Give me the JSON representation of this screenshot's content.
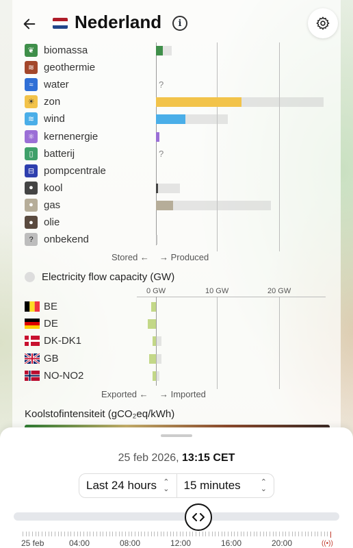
{
  "header": {
    "title": "Nederland",
    "back_icon": "arrow-left-icon",
    "info_icon": "i",
    "settings_icon": "gear-icon"
  },
  "production": {
    "items": [
      {
        "label": "biomassa",
        "icon": "leaf-icon",
        "color": "#3f8f4a",
        "symbol": "❦",
        "produced": 0.04,
        "capacity": 0.09
      },
      {
        "label": "geothermie",
        "icon": "geothermal-icon",
        "color": "#a3472b",
        "symbol": "≋",
        "produced": 0,
        "capacity": 0
      },
      {
        "label": "water",
        "icon": "water-icon",
        "color": "#2f6fd6",
        "symbol": "≈",
        "produced": null,
        "capacity": null,
        "unknown": "?"
      },
      {
        "label": "zon",
        "icon": "sun-icon",
        "color": "#f2c34a",
        "symbol": "☀",
        "produced": 0.5,
        "capacity": 0.98
      },
      {
        "label": "wind",
        "icon": "wind-icon",
        "color": "#4aaee8",
        "symbol": "≋",
        "produced": 0.17,
        "capacity": 0.42
      },
      {
        "label": "kernenergie",
        "icon": "atom-icon",
        "color": "#9b6fd6",
        "symbol": "⚛",
        "produced": 0.02,
        "capacity": 0.02
      },
      {
        "label": "batterij",
        "icon": "battery-icon",
        "color": "#3fa06a",
        "symbol": "▯",
        "produced": null,
        "capacity": null,
        "unknown": "?"
      },
      {
        "label": "pompcentrale",
        "icon": "pump-icon",
        "color": "#2e3fae",
        "symbol": "⊟",
        "produced": 0,
        "capacity": 0
      },
      {
        "label": "kool",
        "icon": "coal-icon",
        "color": "#444444",
        "symbol": "●",
        "produced": 0.01,
        "capacity": 0.14
      },
      {
        "label": "gas",
        "icon": "gas-icon",
        "color": "#b6ad99",
        "symbol": "●",
        "produced": 0.1,
        "capacity": 0.67
      },
      {
        "label": "olie",
        "icon": "oil-icon",
        "color": "#5a4a3f",
        "symbol": "●",
        "produced": 0,
        "capacity": 0
      },
      {
        "label": "onbekend",
        "icon": "question-icon",
        "color": "#bdbdbd",
        "symbol": "?",
        "produced": 0.005,
        "capacity": 0
      }
    ],
    "stored_label": "Stored ←",
    "produced_label": "→ Produced"
  },
  "flow": {
    "title": "Electricity flow capacity (GW)",
    "ticks": [
      "0 GW",
      "10 GW",
      "20 GW"
    ],
    "items": [
      {
        "label": "BE",
        "flag": "be-flag-icon",
        "exported": 0.03,
        "imported": 0
      },
      {
        "label": "DE",
        "flag": "de-flag-icon",
        "exported": 0.05,
        "imported": 0
      },
      {
        "label": "DK-DK1",
        "flag": "dk-flag-icon",
        "exported": 0.02,
        "imported": 0.03
      },
      {
        "label": "GB",
        "flag": "gb-flag-icon",
        "exported": 0.04,
        "imported": 0.03
      },
      {
        "label": "NO-NO2",
        "flag": "no-flag-icon",
        "exported": 0.02,
        "imported": 0.02
      }
    ],
    "exported_label": "Exported ←",
    "imported_label": "→ Imported"
  },
  "carbon": {
    "title": "Koolstofintensiteit (gCO₂eq/kWh)"
  },
  "time": {
    "date": "25 feb 2026,",
    "time": "13:15 CET",
    "range_label": "Last 24 hours",
    "interval_label": "15 minutes",
    "slider_position": 0.54,
    "tick_labels": [
      "25 feb",
      "04:00",
      "08:00",
      "12:00",
      "16:00",
      "20:00"
    ]
  },
  "colors": {
    "accent": "#111111",
    "live": "#c0392b"
  }
}
